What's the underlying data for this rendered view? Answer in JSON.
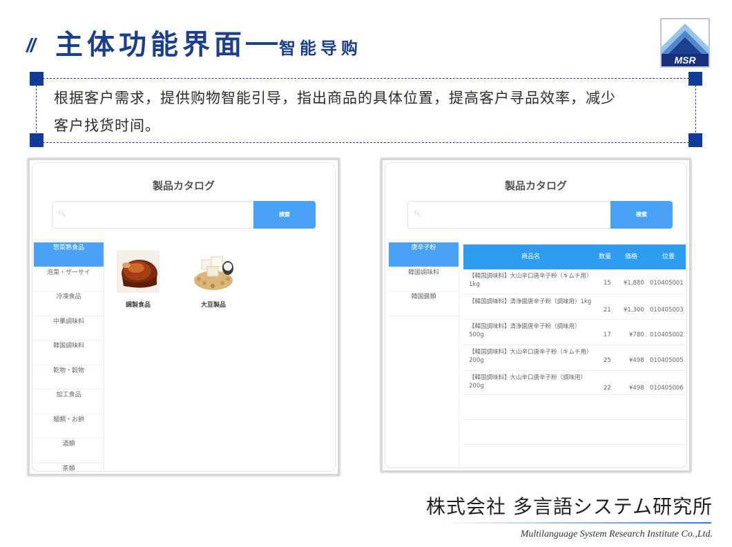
{
  "header": {
    "slashes": "//",
    "title_main": "主体功能界面",
    "title_sub": "智能导购",
    "logo_text": "MSR"
  },
  "description": {
    "line1": "根据客户需求，提供购物智能引导，指出商品的具体位置，提高客户寻品效率，减少",
    "line2": "客户找货时间。"
  },
  "left_screen": {
    "catalog_title": "製品カタログ",
    "search_button": "検索",
    "sidebar": [
      "惣菜熟食品",
      "泡菜・ザーサイ",
      "冷凍食品",
      "中華調味料",
      "韓国調味料",
      "乾物・穀物",
      "加工食品",
      "麺類・お餅",
      "酒類",
      "茶類"
    ],
    "products": [
      {
        "label": "調製食品",
        "icon": "braised-meat-image"
      },
      {
        "label": "大豆製品",
        "icon": "tofu-soybean-image"
      }
    ]
  },
  "right_screen": {
    "catalog_title": "製品カタログ",
    "search_button": "検索",
    "sidebar": [
      "唐辛子粉",
      "韓国調味料",
      "韓国醤類"
    ],
    "table": {
      "headers": [
        "商品名",
        "数量",
        "価格",
        "位置"
      ],
      "rows": [
        {
          "name": "【韓国調味料】大山辛口唐辛子粉（キムチ用）1kg",
          "qty": "15",
          "price": "¥1,880",
          "loc": "010405001"
        },
        {
          "name": "【韓国調味料】清浄園唐辛子粉（調味用）1kg",
          "qty": "21",
          "price": "¥1,300",
          "loc": "010405003"
        },
        {
          "name": "【韓国調味料】清浄園唐辛子粉（調味用）500g",
          "qty": "17",
          "price": "¥780",
          "loc": "010405002"
        },
        {
          "name": "【韓国調味料】大山辛口唐辛子粉（キムチ用）200g",
          "qty": "25",
          "price": "¥498",
          "loc": "010405005"
        },
        {
          "name": "【韓国調味料】大山辛口唐辛子粉（調味用）200g",
          "qty": "22",
          "price": "¥498",
          "loc": "010405006"
        }
      ]
    }
  },
  "footer": {
    "company_ja": "株式会社  多言語システム研究所",
    "company_en": "Multilanguage System Research Institute Co.,Ltd."
  },
  "colors": {
    "brand": "#1c3f8c",
    "accent": "#4aa2f7",
    "table_header": "#2e9cf0"
  }
}
